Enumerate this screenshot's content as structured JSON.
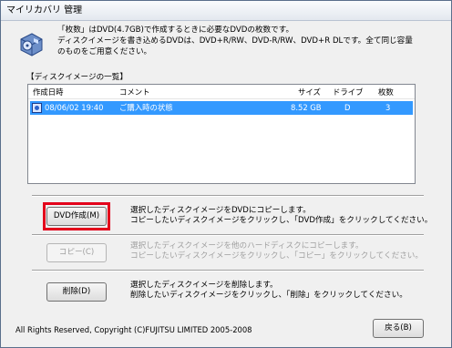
{
  "window": {
    "title": "マイリカバリ 管理"
  },
  "intro": {
    "lines": [
      "「枚数」はDVD(4.7GB)で作成するときに必要なDVDの枚数です。",
      "ディスクイメージを書き込めるDVDは、DVD+R/RW、DVD-R/RW、DVD+R DLです。全て同じ容量",
      "のものをご用意ください。"
    ]
  },
  "list": {
    "label": "【ディスクイメージの一覧】",
    "columns": [
      "作成日時",
      "コメント",
      "サイズ",
      "ドライブ",
      "枚数"
    ],
    "rows": [
      {
        "date": "08/06/02 19:40",
        "comment": "ご購入時の状態",
        "size": "8.52 GB",
        "drive": "D",
        "count": "3"
      }
    ]
  },
  "actions": {
    "create": {
      "label": "DVD作成(M)",
      "desc": [
        "選択したディスクイメージをDVDにコピーします。",
        "コピーしたいディスクイメージをクリックし、「DVD作成」をクリックしてください。"
      ]
    },
    "copy": {
      "label": "コピー(C)",
      "desc": [
        "選択したディスクイメージを他のハードディスクにコピーします。",
        "コピーしたいディスクイメージをクリックし、「コピー」をクリックしてください。"
      ]
    },
    "delete": {
      "label": "削除(D)",
      "desc": [
        "選択したディスクイメージを削除します。",
        "削除したいディスクイメージをクリックし、「削除」をクリックしてください。"
      ]
    }
  },
  "footer": {
    "copyright": "All Rights Reserved, Copyright (C)FUJITSU LIMITED 2005-2008",
    "back_label": "戻る(B)"
  },
  "colors": {
    "selection": "#3399ff",
    "highlight_frame": "#e3001b"
  }
}
